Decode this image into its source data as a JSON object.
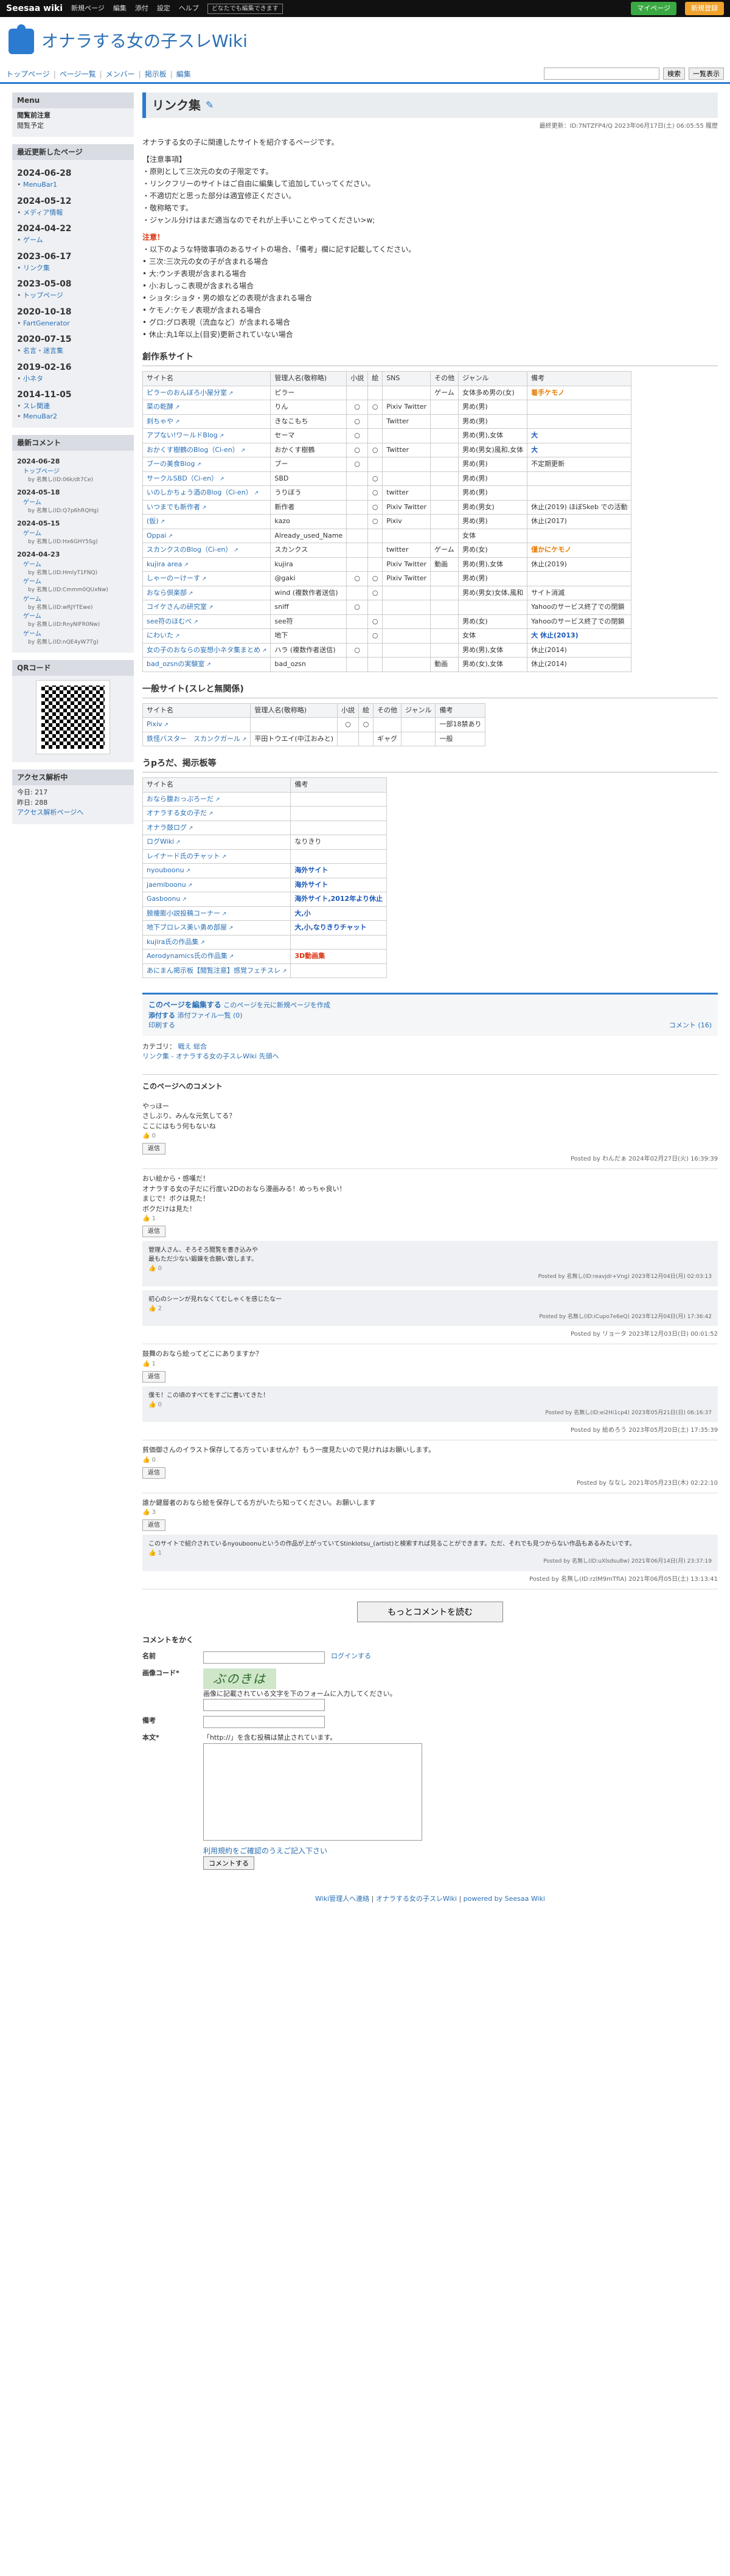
{
  "topbar": {
    "logo": "Seesaa wiki",
    "items": [
      "新規ページ",
      "編集",
      "添付",
      "設定",
      "ヘルプ"
    ],
    "tag": "どなたでも編集できます",
    "my_page": "マイページ",
    "signup": "新規登録"
  },
  "site": {
    "title": "オナラする女の子スレWiki"
  },
  "nav": {
    "items": [
      "トップページ",
      "ページ一覧",
      "メンバー",
      "掲示板",
      "編集"
    ],
    "search": "検索",
    "list": "一覧表示"
  },
  "side": {
    "menu_h": "Menu",
    "menu_items": [
      "閲覧前注意",
      "閲覧予定"
    ],
    "recent_h": "最近更新したページ",
    "recent": [
      {
        "date": "2024-06-28",
        "pages": [
          "MenuBar1"
        ]
      },
      {
        "date": "2024-05-12",
        "pages": [
          "メディア情報"
        ]
      },
      {
        "date": "2024-04-22",
        "pages": [
          "ゲーム"
        ]
      },
      {
        "date": "2023-06-17",
        "pages": [
          "リンク集"
        ]
      },
      {
        "date": "2023-05-08",
        "pages": [
          "トップページ"
        ]
      },
      {
        "date": "2020-10-18",
        "pages": [
          "FartGenerator"
        ]
      },
      {
        "date": "2020-07-15",
        "pages": [
          "名言・迷言集"
        ]
      },
      {
        "date": "2019-02-16",
        "pages": [
          "小ネタ"
        ]
      },
      {
        "date": "2014-11-05",
        "pages": [
          "スレ関連",
          "MenuBar2"
        ]
      }
    ],
    "comments_h": "最新コメント",
    "comments": [
      {
        "date": "2024-06-28",
        "items": [
          {
            "page": "トップページ",
            "by": "by 名無し(ID:06k/dt7Ce)"
          }
        ]
      },
      {
        "date": "2024-05-18",
        "items": [
          {
            "page": "ゲーム",
            "by": "by 名無し(ID:Q7p6hRQHg)"
          }
        ]
      },
      {
        "date": "2024-05-15",
        "items": [
          {
            "page": "ゲーム",
            "by": "by 名無し(ID:Hx6GHY5Sg)"
          }
        ]
      },
      {
        "date": "2024-04-23",
        "items": [
          {
            "page": "ゲーム",
            "by": "by 名無し(ID:HmlyT1FNQ)"
          },
          {
            "page": "ゲーム",
            "by": "by 名無し(ID:Cmmm0QUxNw)"
          },
          {
            "page": "ゲーム",
            "by": "by 名無し(ID:wRJYTEwe)"
          },
          {
            "page": "ゲーム",
            "by": "by 名無し(ID:RnyNlFR0Nw)"
          },
          {
            "page": "ゲーム",
            "by": "by 名無し(ID:nQE4yW7Tg)"
          }
        ]
      }
    ],
    "qr_h": "QRコード",
    "access_h": "アクセス解析中",
    "today": "今日: 217",
    "yesterday": "昨日: 288",
    "access_link": "アクセス解析ページへ"
  },
  "page": {
    "title": "リンク集",
    "meta": "最終更新：ID:7NTZFP4/Q 2023年06月17日(土) 06:05:55 履歴",
    "intro": "オナラする女の子に関連したサイトを紹介するページです。",
    "notes_h": "【注意事項】",
    "notes": [
      "・原則として三次元の女の子限定です。",
      "・リンクフリーのサイトはご自由に編集して追加していってください。",
      "・不適切だと思った部分は適宜修正ください。",
      "・敬称略です。",
      "・ジャンル分けはまだ適当なのでそれが上手いことやってください>w;"
    ],
    "warn_h": "注意！",
    "warn_intro": "・以下のような特徴事項のあるサイトの場合、「備考」欄に記す記載してください。",
    "warn_items": [
      "三次:三次元の女の子が含まれる場合",
      "大:ウンチ表現が含まれる場合",
      "小:おしっこ表現が含まれる場合",
      "ショタ:ショタ・男の娘などの表現が含まれる場合",
      "ケモノ:ケモノ表現が含まれる場合",
      "グロ:グロ表現（流血など）が含まれる場合",
      "休止:丸1年以上(目安)更新されていない場合"
    ]
  },
  "sec1": {
    "h": "創作系サイト",
    "cols": [
      "サイト名",
      "管理人名(敬称略)",
      "小説",
      "絵",
      "SNS",
      "その他",
      "ジャンル",
      "備考"
    ],
    "rows": [
      [
        "ピラーのおんぼろ小屋分室",
        "ピラー",
        "",
        "",
        "",
        "ゲーム",
        "女体多め男の(女)",
        "着手ケモノ"
      ],
      [
        "菜の乾酵",
        "りん",
        "○",
        "○",
        "Pixiv Twitter",
        "",
        "男め(男)",
        ""
      ],
      [
        "刹ちゃや",
        "きなこもち",
        "○",
        "",
        "Twitter",
        "",
        "男め(男)",
        ""
      ],
      [
        "アプない!ワールドBlog",
        "セーマ",
        "○",
        "",
        "",
        "",
        "男め(男),女体",
        "大"
      ],
      [
        "おかくす樹鶴のBlog（Ci-en）",
        "おかくす樹鶴",
        "○",
        "○",
        "Twitter",
        "",
        "男め(男女)風和,女体",
        "大"
      ],
      [
        "ブーの美食Blog",
        "ブー",
        "○",
        "",
        "",
        "",
        "男め(男)",
        "不定期更新"
      ],
      [
        "サークルSBD（Ci-en）",
        "SBD",
        "",
        "○",
        "",
        "",
        "男め(男)",
        ""
      ],
      [
        "いのしかちょう酒のBlog（Ci-en）",
        "うりぼう",
        "",
        "○",
        "twitter",
        "",
        "男め(男)",
        ""
      ],
      [
        "いつまでも新作者",
        "新作者",
        "",
        "○",
        "Pixiv Twitter",
        "",
        "男め(男女)",
        "休止(2019) ほぼSkeb での活動"
      ],
      [
        "(仮)",
        "kazo",
        "",
        "○",
        "Pixiv",
        "",
        "男め(男)",
        "休止(2017)"
      ],
      [
        "Oppai",
        "Already_used_Name",
        "",
        "",
        "",
        "",
        "女体",
        ""
      ],
      [
        "スカンクスのBlog（Ci-en）",
        "スカンクス",
        "",
        "",
        "twitter",
        "ゲーム",
        "男め(女)",
        "僅かにケモノ"
      ],
      [
        "kujira area",
        "kujira",
        "",
        "",
        "Pixiv Twitter",
        "動画",
        "男め(男),女体",
        "休止(2019)"
      ],
      [
        "しゃーのーけーす",
        "@gaki",
        "○",
        "○",
        "Pixiv Twitter",
        "",
        "男め(男)",
        ""
      ],
      [
        "おなら倶楽部",
        "wind (複数作者送信)",
        "",
        "○",
        "",
        "",
        "男め(男女)女体,風和",
        "サイト消滅"
      ],
      [
        "コイケさんの研究室",
        "sniff",
        "○",
        "",
        "",
        "",
        "",
        "Yahooのサービス終了での閉鎖"
      ],
      [
        "see符のほむべ",
        "see符",
        "",
        "○",
        "",
        "",
        "男め(女)",
        "Yahooのサービス終了での閉鎖"
      ],
      [
        "にわいた",
        "地下",
        "",
        "○",
        "",
        "",
        "女体",
        "大 休止(2013)"
      ],
      [
        "女の子のおならの妄想小ネタ集まとめ",
        "ハラ (複数作者送信)",
        "○",
        "",
        "",
        "",
        "男め(男),女体",
        "休止(2014)"
      ],
      [
        "bad_ozsnの実験室",
        "bad_ozsn",
        "",
        "",
        "",
        "動画",
        "男め(女),女体",
        "休止(2014)"
      ]
    ]
  },
  "sec2": {
    "h": "一般サイト(スレと無関係)",
    "cols": [
      "サイト名",
      "管理人名(敬称略)",
      "小説",
      "絵",
      "その他",
      "ジャンル",
      "備考"
    ],
    "rows": [
      [
        "Pixiv",
        "",
        "○",
        "○",
        "",
        "",
        "一部18禁あり"
      ],
      [
        "鉄怪バスター　スカンクガール",
        "平田トウエイ(中江おみと)",
        "",
        "",
        "ギャグ",
        "",
        "一般"
      ]
    ]
  },
  "sec3": {
    "h": "うpろだ、掲示板等",
    "cols": [
      "サイト名",
      "備考"
    ],
    "rows": [
      [
        "おなら腹おっぷろーだ",
        ""
      ],
      [
        "オナラする女の子だ",
        ""
      ],
      [
        "オナラ鼓ログ",
        ""
      ],
      [
        "ログWiki",
        "なりきり"
      ],
      [
        "レイナード氏のチャット",
        ""
      ],
      [
        "nyouboonu",
        "海外サイト"
      ],
      [
        "jaemiboonu",
        "海外サイト"
      ],
      [
        "Gasboonu",
        "海外サイト,2012年より休止"
      ],
      [
        "膀痩膨小説投稿コーナー",
        "大,小"
      ],
      [
        "地下ブロレス美い勇め部屋",
        "大,小,なりきりチャット"
      ],
      [
        "kujira氏の作品集",
        ""
      ],
      [
        "Aerodynamics氏の作品集",
        "3D動画集"
      ],
      [
        "あにまん掲示板【閲覧注意】感覚フェチスレ",
        ""
      ]
    ]
  },
  "edit": {
    "title": "このページを編集する",
    "sub": "このページを元に新規ページを作成",
    "attach": "添付する",
    "attach_sub": "添付ファイル一覧 (0)",
    "print": "印刷する",
    "comment": "コメント (16)"
  },
  "category": {
    "label": "カテゴリ：",
    "items": [
      "戦え",
      "総合"
    ],
    "breadcrumb": "リンク集 - オナラする女の子スレWiki 先頭へ"
  },
  "comments": {
    "h": "このページへのコメント",
    "list": [
      {
        "text": "やっほー\nさしぶり、みんな元気してる？\nここにはもう何もないね",
        "likes": "0",
        "foot": "Posted by わんだぁ 2024年02月27日(火) 16:39:39",
        "subs": []
      },
      {
        "text": "おい絵から・感嘆だ！\nオナラする女の子だに行度い2Dのおなら漫画みる！めっちゃ良い！\nまじで！ボクは見た！\nボクだけは見た！",
        "likes": "1",
        "foot": "Posted by リョータ 2023年12月03日(日) 00:01:52",
        "subs": [
          {
            "text": "管理人さん、そろそろ閲覧を書き込みや\n最もただ少ない鍛錬を合願い致します。",
            "likes": "0",
            "foot": "Posted by 名無し(ID:reavjdr+Vng) 2023年12月04日(月) 02:03:13"
          },
          {
            "text": "初心のシーンが見れなくてむしゃくを感じたなー",
            "likes": "2",
            "foot": "Posted by 名無し(ID:iCupo7e6eQ) 2023年12月04日(月) 17:36:42"
          }
        ]
      },
      {
        "text": "鼓舞のおなら絵ってどこにありますか？",
        "likes": "1",
        "foot": "Posted by 絵めろう 2023年05月20日(土) 17:35:39",
        "subs": [
          {
            "text": "僕モ！この頃のすべてをすごに書いてきた！",
            "likes": "0",
            "foot": "Posted by 名無し(ID:ei2Hi1cp4) 2023年05月21日(日) 06:16:37"
          }
        ]
      },
      {
        "text": "貧価御さんのイラスト保存してる方っていませんか？もう一度見たいので見けれはお願いします。",
        "likes": "0",
        "foot": "Posted by ななし 2021年05月23日(木) 02:22:10",
        "subs": []
      },
      {
        "text": "誰か鍵層者のおなら絵を保存してる方がいたら知ってください。お願いします",
        "likes": "3",
        "foot": "Posted by 名無し(ID:rzlM9mTfiA) 2021年06月05日(土) 13:13:41",
        "subs": [
          {
            "text": "このサイトで紹介されているnyouboonuというの作品が上がっていてStinklotsu_(artist)と検索すれば見ることができます。ただ、それでも見つからない作品もあるみたいです。",
            "likes": "1",
            "foot": "Posted by 名無し(ID:uXlsdsu8w) 2021年06月14日(月) 23:37:19"
          }
        ]
      }
    ],
    "more": "もっとコメントを読む"
  },
  "form": {
    "h": "コメントをかく",
    "name_label": "名前",
    "login": "ログインする",
    "captcha_label": "画像コード*",
    "captcha_text": "ぶのきは",
    "captcha_note": "画像に記載されている文字を下のフォームに入力してください。",
    "note_label": "備考",
    "body_label": "本文*",
    "http_note": "「http://」を含む投稿は禁止されています。",
    "terms": "利用規約をご確認のうえご記入下さい",
    "submit": "コメントする"
  },
  "footer": {
    "items": [
      "Wiki管理人へ連絡",
      "オナラする女の子スレWiki",
      "powered by Seesaa Wiki"
    ]
  }
}
